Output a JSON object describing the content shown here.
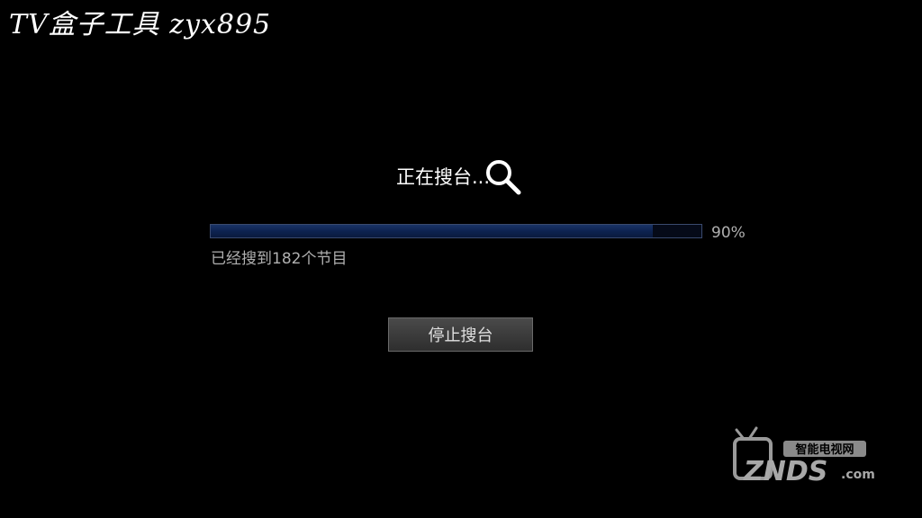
{
  "watermark": {
    "text": "TV盒子工具 zyx895"
  },
  "scan": {
    "title": "正在搜台...",
    "progress_fraction": 0.9,
    "progress_label": "90%",
    "found_text": "已经搜到182个节目",
    "stop_label": "停止搜台",
    "icon": "search-icon"
  },
  "brand": {
    "top_text": "智能电视网",
    "main_text": "ZNDS",
    "suffix_text": ".com",
    "icon": "tv-icon"
  },
  "colors": {
    "background": "#000000",
    "progress_fill": "#0d2350",
    "progress_border": "#3a4a6e",
    "text_primary": "#ffffff",
    "text_secondary": "#b0b0b0"
  }
}
